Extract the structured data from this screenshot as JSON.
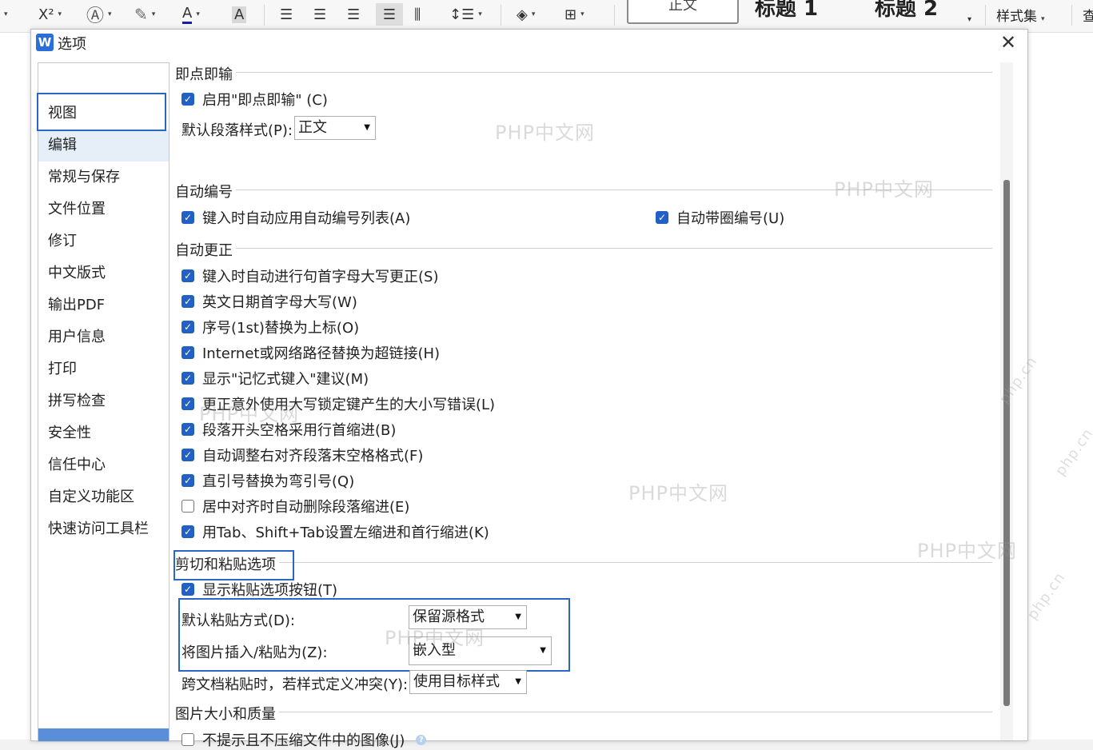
{
  "toolbar": {
    "superscript": "X²",
    "font_color_glyph": "A",
    "shade_glyph": "A",
    "style_normal": "正文",
    "style_h1": "标题 1",
    "style_h2": "标题 2",
    "styles_set": "样式集",
    "corner_text": "查"
  },
  "dialog": {
    "app_logo": "W",
    "title": "选项",
    "close_glyph": "✕"
  },
  "nav": {
    "items": [
      "视图",
      "编辑",
      "常规与保存",
      "文件位置",
      "修订",
      "中文版式",
      "输出PDF",
      "用户信息",
      "打印",
      "拼写检查",
      "安全性",
      "信任中心",
      "自定义功能区",
      "快速访问工具栏"
    ],
    "selected": "编辑"
  },
  "sections": {
    "click_type": {
      "title": "即点即输",
      "enable": {
        "label": "启用\"即点即输\" (C)",
        "checked": true
      },
      "default_style_label": "默认段落样式(P):",
      "default_style_value": "正文"
    },
    "auto_number": {
      "title": "自动编号",
      "apply_list": {
        "label": "键入时自动应用自动编号列表(A)",
        "checked": true
      },
      "circle_number": {
        "label": "自动带圈编号(U)",
        "checked": true
      }
    },
    "auto_correct": {
      "title": "自动更正",
      "items": [
        {
          "label": "键入时自动进行句首字母大写更正(S)",
          "checked": true
        },
        {
          "label": "英文日期首字母大写(W)",
          "checked": true
        },
        {
          "label": "序号(1st)替换为上标(O)",
          "checked": true
        },
        {
          "label": "Internet或网络路径替换为超链接(H)",
          "checked": true
        },
        {
          "label": "显示\"记忆式键入\"建议(M)",
          "checked": true
        },
        {
          "label": "更正意外使用大写锁定键产生的大小写错误(L)",
          "checked": true
        },
        {
          "label": "段落开头空格采用行首缩进(B)",
          "checked": true
        },
        {
          "label": "自动调整右对齐段落末空格格式(F)",
          "checked": true
        },
        {
          "label": "直引号替换为弯引号(Q)",
          "checked": true
        },
        {
          "label": "居中对齐时自动删除段落缩进(E)",
          "checked": false
        },
        {
          "label": "用Tab、Shift+Tab设置左缩进和首行缩进(K)",
          "checked": true
        }
      ]
    },
    "cut_paste": {
      "title": "剪切和粘贴选项",
      "show_button": {
        "label": "显示粘贴选项按钮(T)",
        "checked": true
      },
      "default_paste_label": "默认粘贴方式(D):",
      "default_paste_value": "保留源格式",
      "image_paste_label": "将图片插入/粘贴为(Z):",
      "image_paste_value": "嵌入型",
      "cross_doc_label": "跨文档粘贴时，若样式定义冲突(Y):",
      "cross_doc_value": "使用目标样式"
    },
    "image_quality": {
      "title": "图片大小和质量",
      "no_compress": {
        "label": "不提示且不压缩文件中的图像(J)",
        "checked": false
      }
    }
  },
  "watermarks": [
    "PHP中文网",
    "PHP中文网",
    "PHP中文网",
    "PHP中文网",
    "PHP中文网",
    "PHP中文网",
    "php.cn",
    "php.cn",
    "php.cn"
  ],
  "colors": {
    "accent": "#2160c4",
    "highlight": "#2a67c4",
    "nav_selected": "#e6eef8"
  }
}
